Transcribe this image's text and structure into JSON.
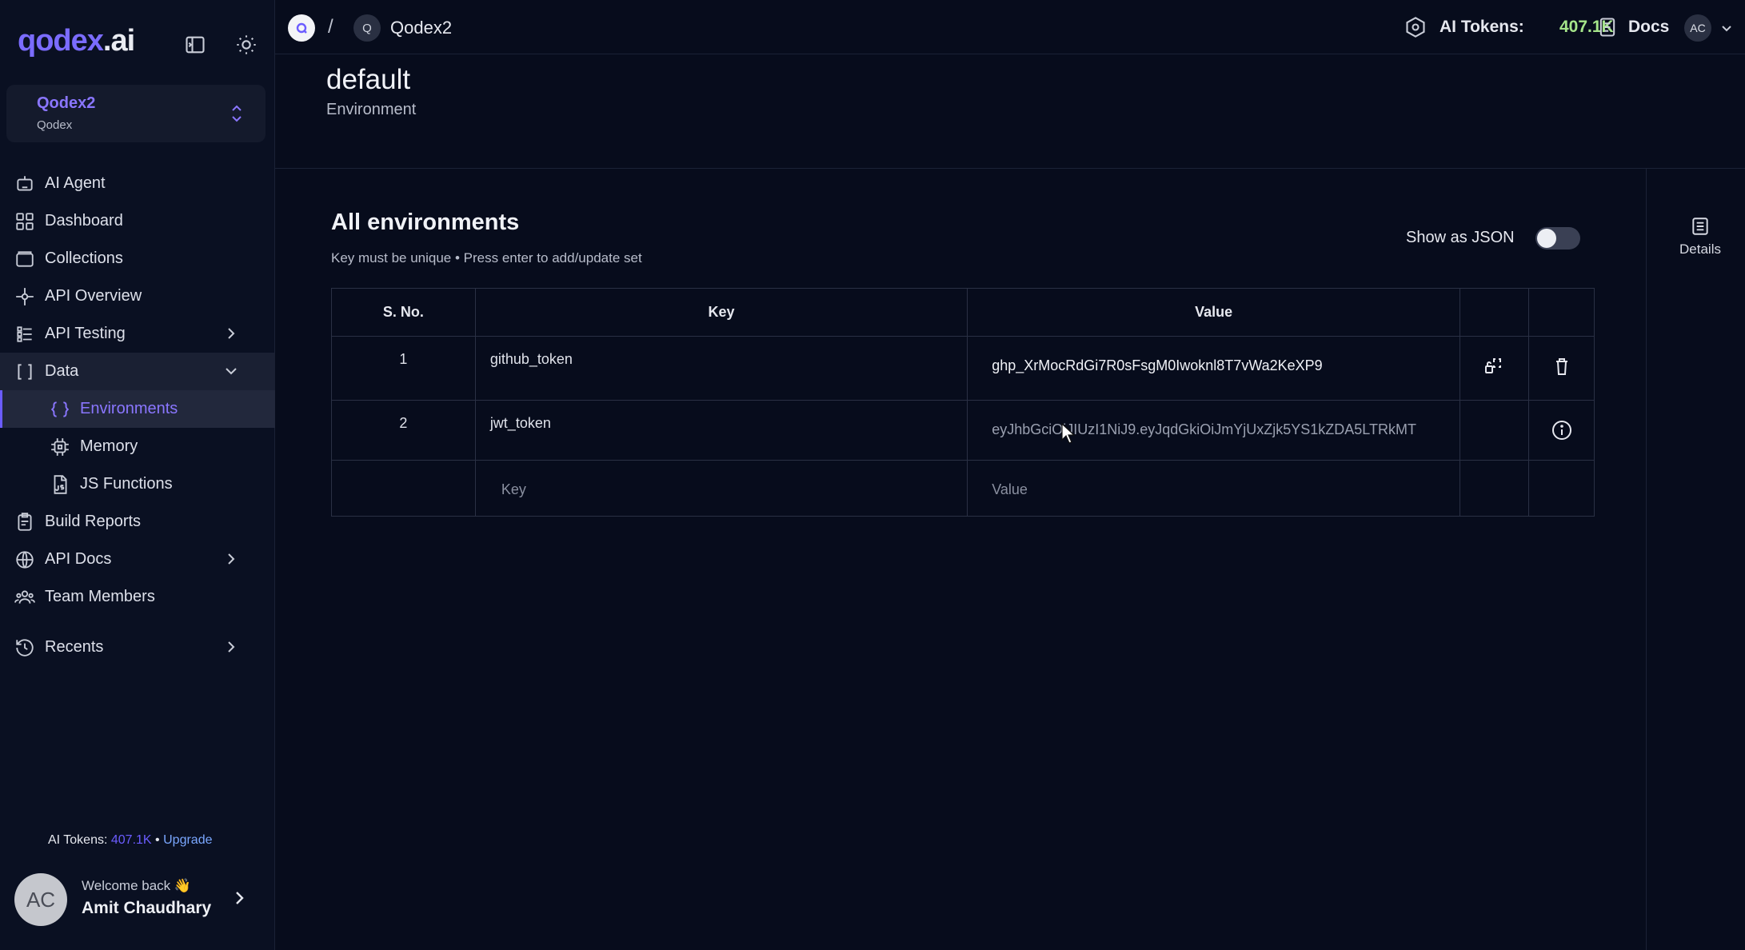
{
  "app": {
    "logo_main": "qodex",
    "logo_suffix": ".ai"
  },
  "project": {
    "name": "Qodex2",
    "org": "Qodex"
  },
  "nav": {
    "items": [
      {
        "label": "AI Agent",
        "icon": "robot-icon"
      },
      {
        "label": "Dashboard",
        "icon": "grid-icon"
      },
      {
        "label": "Collections",
        "icon": "folder-icon"
      },
      {
        "label": "API Overview",
        "icon": "api-icon"
      },
      {
        "label": "API Testing",
        "icon": "test-icon",
        "expandable": true
      },
      {
        "label": "Data",
        "icon": "brackets-icon",
        "expanded": true
      },
      {
        "label": "Environments",
        "icon": "braces-icon",
        "selected": true
      },
      {
        "label": "Memory",
        "icon": "chip-icon"
      },
      {
        "label": "JS Functions",
        "icon": "js-file-icon"
      },
      {
        "label": "Build Reports",
        "icon": "report-icon"
      },
      {
        "label": "API Docs",
        "icon": "globe-icon",
        "expandable": true
      },
      {
        "label": "Team Members",
        "icon": "team-icon"
      },
      {
        "label": "Recents",
        "icon": "history-icon",
        "expandable": true
      }
    ]
  },
  "sidebar_footer": {
    "tokens_label": "AI Tokens:",
    "tokens_value": "407.1K",
    "separator": "•",
    "upgrade": "Upgrade",
    "avatar_initials": "AC",
    "welcome": "Welcome back 👋",
    "user_name": "Amit Chaudhary"
  },
  "topbar": {
    "breadcrumb_sep": "/",
    "breadcrumb_project_initial": "Q",
    "breadcrumb_project": "Qodex2",
    "tokens_label": "AI Tokens:",
    "tokens_value": "407.1K",
    "docs": "Docs",
    "avatar_initials": "AC"
  },
  "page": {
    "title": "default",
    "subtitle": "Environment",
    "details_label": "Details"
  },
  "section": {
    "title": "All environments",
    "hint": "Key must be unique • Press enter to add/update set",
    "json_toggle_label": "Show as JSON",
    "json_toggle_on": false
  },
  "table": {
    "headers": {
      "sno": "S. No.",
      "key": "Key",
      "value": "Value"
    },
    "rows": [
      {
        "sno": "1",
        "key": "github_token",
        "value": "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"
      },
      {
        "sno": "2",
        "key": "jwt_token",
        "value": "eyJhbGciOiJIUzI1NiJ9.eyJqdGkiOiJmYjUxZjk5YS1kZDA5LTRkMT"
      }
    ],
    "new_row": {
      "key_placeholder": "Key",
      "value_placeholder": "Value"
    }
  },
  "colors": {
    "accent": "#6b5cff",
    "token_value": "#a5e58a",
    "background": "#070c1c"
  }
}
